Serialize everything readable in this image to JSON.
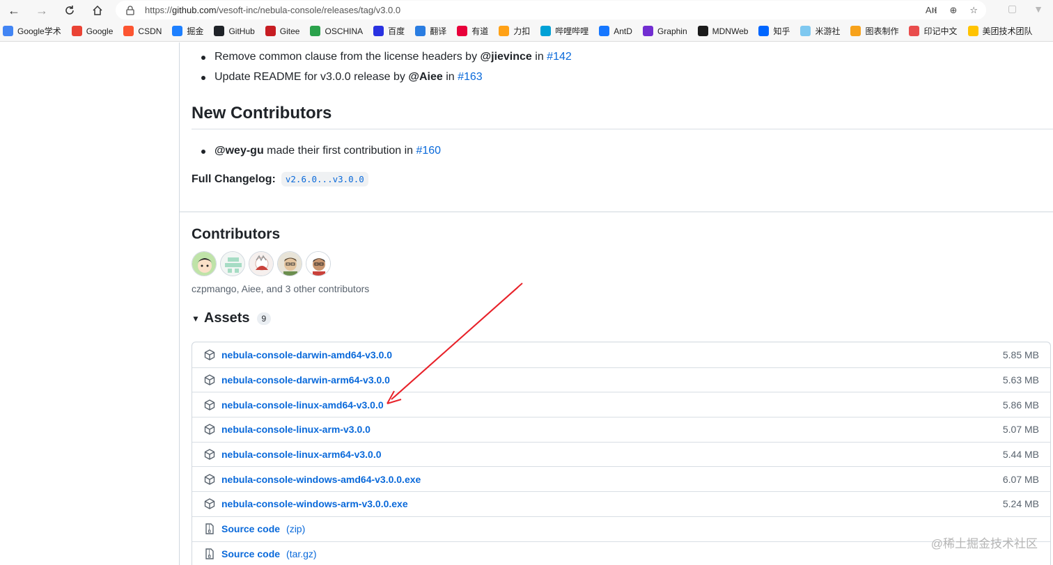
{
  "browser": {
    "url_prefix": "https://",
    "url_host": "github.com",
    "url_path": "/vesoft-inc/nebula-console/releases/tag/v3.0.0",
    "bookmarks": [
      {
        "label": "Google学术",
        "icon": "google-scholar-icon",
        "color": "#4285f4"
      },
      {
        "label": "Google",
        "icon": "google-icon",
        "color": "#ea4335"
      },
      {
        "label": "CSDN",
        "icon": "csdn-icon",
        "color": "#fc5531"
      },
      {
        "label": "掘金",
        "icon": "juejin-icon",
        "color": "#1e80ff"
      },
      {
        "label": "GitHub",
        "icon": "github-icon",
        "color": "#1f2328"
      },
      {
        "label": "Gitee",
        "icon": "gitee-icon",
        "color": "#c71d23"
      },
      {
        "label": "OSCHINA",
        "icon": "oschina-icon",
        "color": "#2ba24c"
      },
      {
        "label": "百度",
        "icon": "baidu-icon",
        "color": "#2932e1"
      },
      {
        "label": "翻译",
        "icon": "translate-icon",
        "color": "#2a7de1"
      },
      {
        "label": "有道",
        "icon": "youdao-icon",
        "color": "#e8003a"
      },
      {
        "label": "力扣",
        "icon": "leetcode-icon",
        "color": "#ffa116"
      },
      {
        "label": "哔哩哔哩",
        "icon": "bilibili-icon",
        "color": "#00a1d6"
      },
      {
        "label": "AntD",
        "icon": "antd-icon",
        "color": "#1677ff"
      },
      {
        "label": "Graphin",
        "icon": "graphin-icon",
        "color": "#722ed1"
      },
      {
        "label": "MDNWeb",
        "icon": "mdn-icon",
        "color": "#1b1b1b"
      },
      {
        "label": "知乎",
        "icon": "zhihu-icon",
        "color": "#0066ff"
      },
      {
        "label": "米游社",
        "icon": "miyoushe-icon",
        "color": "#7ec8f0"
      },
      {
        "label": "图表制作",
        "icon": "chart-icon",
        "color": "#f7a21b"
      },
      {
        "label": "印记中文",
        "icon": "yinji-icon",
        "color": "#e94d4d"
      },
      {
        "label": "美团技术团队",
        "icon": "meituan-icon",
        "color": "#ffc300"
      }
    ]
  },
  "notes": [
    {
      "prefix": "Remove common clause from the license headers by ",
      "user": "@jievince",
      "mid": " in ",
      "pr": "#142"
    },
    {
      "prefix": "Update README for v3.0.0 release by ",
      "user": "@Aiee",
      "mid": " in ",
      "pr": "#163"
    }
  ],
  "new_contributors": {
    "title": "New Contributors",
    "items": [
      {
        "user": "@wey-gu",
        "text": " made their first contribution in ",
        "pr": "#160"
      }
    ]
  },
  "changelog": {
    "label": "Full Changelog:",
    "compare": "v2.6.0...v3.0.0"
  },
  "contributors": {
    "title": "Contributors",
    "summary": "czpmango, Aiee, and 3 other contributors"
  },
  "assets": {
    "title": "Assets",
    "count": "9",
    "items": [
      {
        "name": "nebula-console-darwin-amd64-v3.0.0",
        "size": "5.85 MB"
      },
      {
        "name": "nebula-console-darwin-arm64-v3.0.0",
        "size": "5.63 MB"
      },
      {
        "name": "nebula-console-linux-amd64-v3.0.0",
        "size": "5.86 MB"
      },
      {
        "name": "nebula-console-linux-arm-v3.0.0",
        "size": "5.07 MB"
      },
      {
        "name": "nebula-console-linux-arm64-v3.0.0",
        "size": "5.44 MB"
      },
      {
        "name": "nebula-console-windows-amd64-v3.0.0.exe",
        "size": "6.07 MB"
      },
      {
        "name": "nebula-console-windows-arm-v3.0.0.exe",
        "size": "5.24 MB"
      }
    ],
    "source": [
      {
        "name": "Source code",
        "format": "(zip)"
      },
      {
        "name": "Source code",
        "format": "(tar.gz)"
      }
    ]
  },
  "watermark": "@稀土掘金技术社区",
  "colors": {
    "link": "#0969da",
    "annotation_arrow": "#e8222a"
  }
}
